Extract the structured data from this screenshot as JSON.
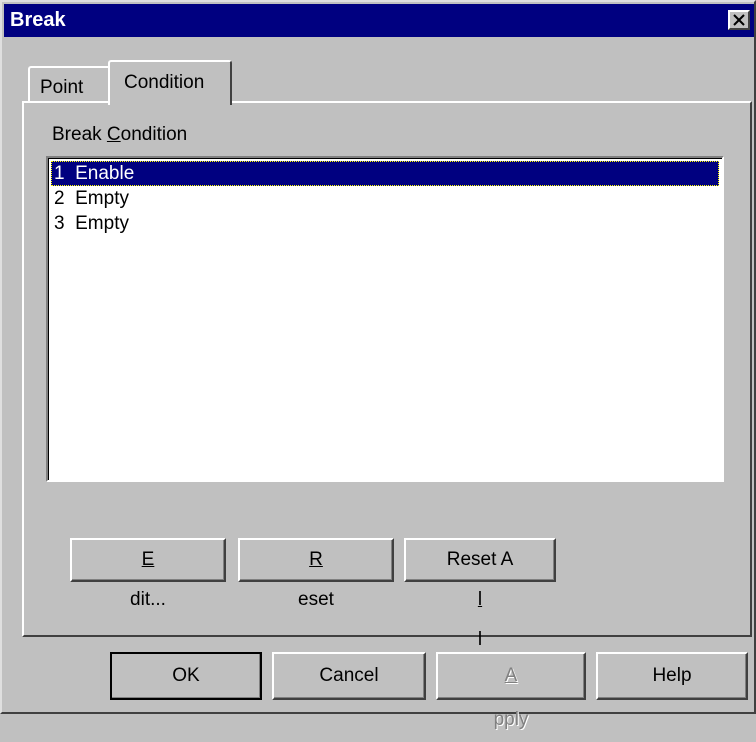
{
  "window": {
    "title": "Break"
  },
  "tabs": [
    {
      "label": "Point"
    },
    {
      "label": "Condition",
      "active": true
    }
  ],
  "group": {
    "label_pre": "Break ",
    "label_access": "C",
    "label_post": "ondition"
  },
  "conditions": [
    {
      "label": "1  Enable",
      "selected": true
    },
    {
      "label": "2  Empty"
    },
    {
      "label": "3  Empty"
    }
  ],
  "actions": {
    "edit": {
      "access": "E",
      "rest": "dit..."
    },
    "reset": {
      "access": "R",
      "rest": "eset"
    },
    "reset_all": {
      "pre": "Reset A",
      "access": "l",
      "rest": "l"
    }
  },
  "footer": {
    "ok": "OK",
    "cancel": "Cancel",
    "apply": {
      "access": "A",
      "rest": "pply",
      "disabled": true
    },
    "help": "Help"
  },
  "colors": {
    "face": "#c0c0c0",
    "titlebar": "#000080",
    "selection": "#000080"
  }
}
